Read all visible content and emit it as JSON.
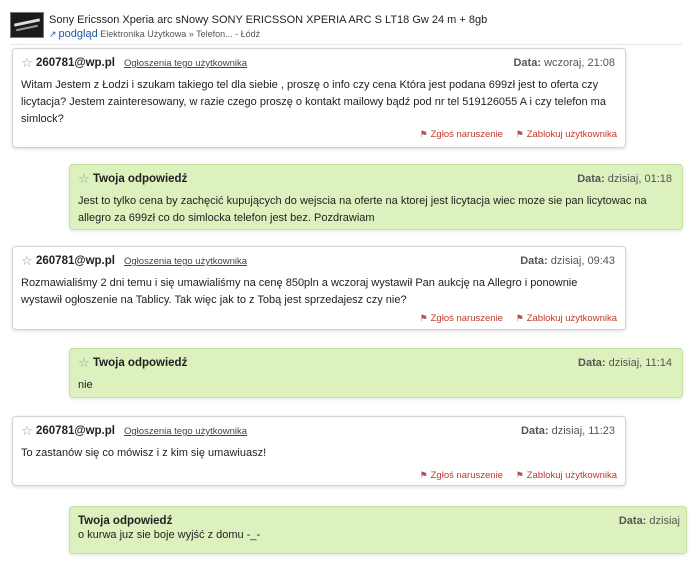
{
  "header": {
    "title": "Sony Ericsson Xperia arc sNowy SONY ERICSSON XPERIA ARC S LT18 Gw 24 m + 8gb",
    "preview_label": "podgląd",
    "breadcrumb": "Elektronika Użytkowa » Telefon... - Łódź"
  },
  "messages": [
    {
      "author": "260781@wp.pl",
      "user_ads": "Ogłoszenia tego użytkownika",
      "date_label": "Data:",
      "date": "wczoraj, 21:08",
      "body": "Witam Jestem z Łodzi i szukam takiego tel dla siebie , proszę o info czy cena Która jest podana 699zł jest to oferta czy licytacja? Jestem zainteresowany, w razie czego proszę o kontakt mailowy bądź pod nr tel 519126055 A i czy telefon ma simlock?",
      "report": "Zgłoś naruszenie",
      "block": "Zablokuj użytkownika"
    },
    {
      "author": "Twoja odpowiedź",
      "date_label": "Data:",
      "date": "dzisiaj, 01:18",
      "body": "Jest to tylko cena by zachęcić kupujących do wejscia na oferte na ktorej jest licytacja wiec moze sie pan licytowac na allegro za 699zł co do simlocka telefon jest bez. Pozdrawiam"
    },
    {
      "author": "260781@wp.pl",
      "user_ads": "Ogłoszenia tego użytkownika",
      "date_label": "Data:",
      "date": "dzisiaj, 09:43",
      "body": "Rozmawialiśmy 2 dni temu i się umawialiśmy na cenę 850pln a wczoraj wystawił Pan aukcję na Allegro i ponownie wystawił ogłoszenie na Tablicy. Tak więc jak to z Tobą jest sprzedajesz czy nie?",
      "report": "Zgłoś naruszenie",
      "block": "Zablokuj użytkownika"
    },
    {
      "author": "Twoja odpowiedź",
      "date_label": "Data:",
      "date": "dzisiaj, 11:14",
      "body": "nie"
    },
    {
      "author": "260781@wp.pl",
      "user_ads": "Ogłoszenia tego użytkownika",
      "date_label": "Data:",
      "date": "dzisiaj, 11:23",
      "body": "To zastanów się co mówisz i z kim się umawiuasz!",
      "report": "Zgłoś naruszenie",
      "block": "Zablokuj użytkownika"
    },
    {
      "author": "Twoja odpowiedź",
      "date_label": "Data:",
      "date": "dzisiaj",
      "body": "o kurwa juz sie boje wyjść z domu -_-"
    }
  ],
  "colors": {
    "reply_bg": "#dcf1bd",
    "incoming_bg": "#ffffff",
    "action_red": "#c0392b",
    "link_blue": "#1b5aa6"
  }
}
